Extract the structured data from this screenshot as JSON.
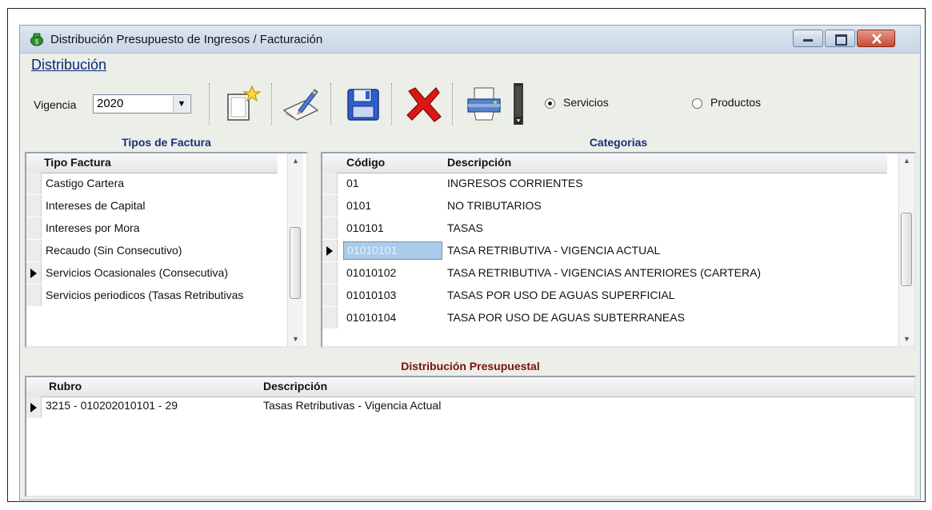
{
  "window": {
    "title": "Distribución Presupuesto de Ingresos / Facturación"
  },
  "menu": {
    "items": [
      "Distribución"
    ]
  },
  "toolbar": {
    "vigencia_label": "Vigencia",
    "vigencia_value": "2020",
    "buttons": [
      "new-icon",
      "edit-icon",
      "save-icon",
      "delete-icon",
      "print-icon",
      "column-icon"
    ],
    "radio_servicios": "Servicios",
    "radio_productos": "Productos",
    "selected_radio": "Servicios"
  },
  "tipos_factura": {
    "title": "Tipos de Factura",
    "column": "Tipo Factura",
    "rows": [
      "Castigo Cartera",
      "Intereses de Capital",
      "Intereses por Mora",
      "Recaudo (Sin Consecutivo)",
      "Servicios Ocasionales (Consecutiva)",
      "Servicios periodicos (Tasas Retributivas"
    ],
    "selected_index": 4
  },
  "categorias": {
    "title": "Categorias",
    "columns": [
      "Código",
      "Descripción"
    ],
    "rows": [
      {
        "codigo": "01",
        "descripcion": "INGRESOS CORRIENTES"
      },
      {
        "codigo": "0101",
        "descripcion": "NO TRIBUTARIOS"
      },
      {
        "codigo": "010101",
        "descripcion": "TASAS"
      },
      {
        "codigo": "01010101",
        "descripcion": "TASA RETRIBUTIVA - VIGENCIA ACTUAL"
      },
      {
        "codigo": "01010102",
        "descripcion": "TASA RETRIBUTIVA - VIGENCIAS ANTERIORES (CARTERA)"
      },
      {
        "codigo": "01010103",
        "descripcion": "TASAS POR USO DE AGUAS SUPERFICIAL"
      },
      {
        "codigo": "01010104",
        "descripcion": "TASA POR USO DE AGUAS SUBTERRANEAS"
      }
    ],
    "selected_index": 3
  },
  "distribucion": {
    "title": "Distribución Presupuestal",
    "columns": [
      "Rubro",
      "Descripción"
    ],
    "rows": [
      {
        "rubro": "3215 - 010202010101 - 29",
        "descripcion": "Tasas Retributivas - Vigencia Actual"
      }
    ]
  },
  "colors": {
    "panel_title_blue": "#1b2f7a",
    "panel_title_dark_red": "#7a1010",
    "selection": "#aacbea",
    "window_bg": "#eceee8"
  }
}
